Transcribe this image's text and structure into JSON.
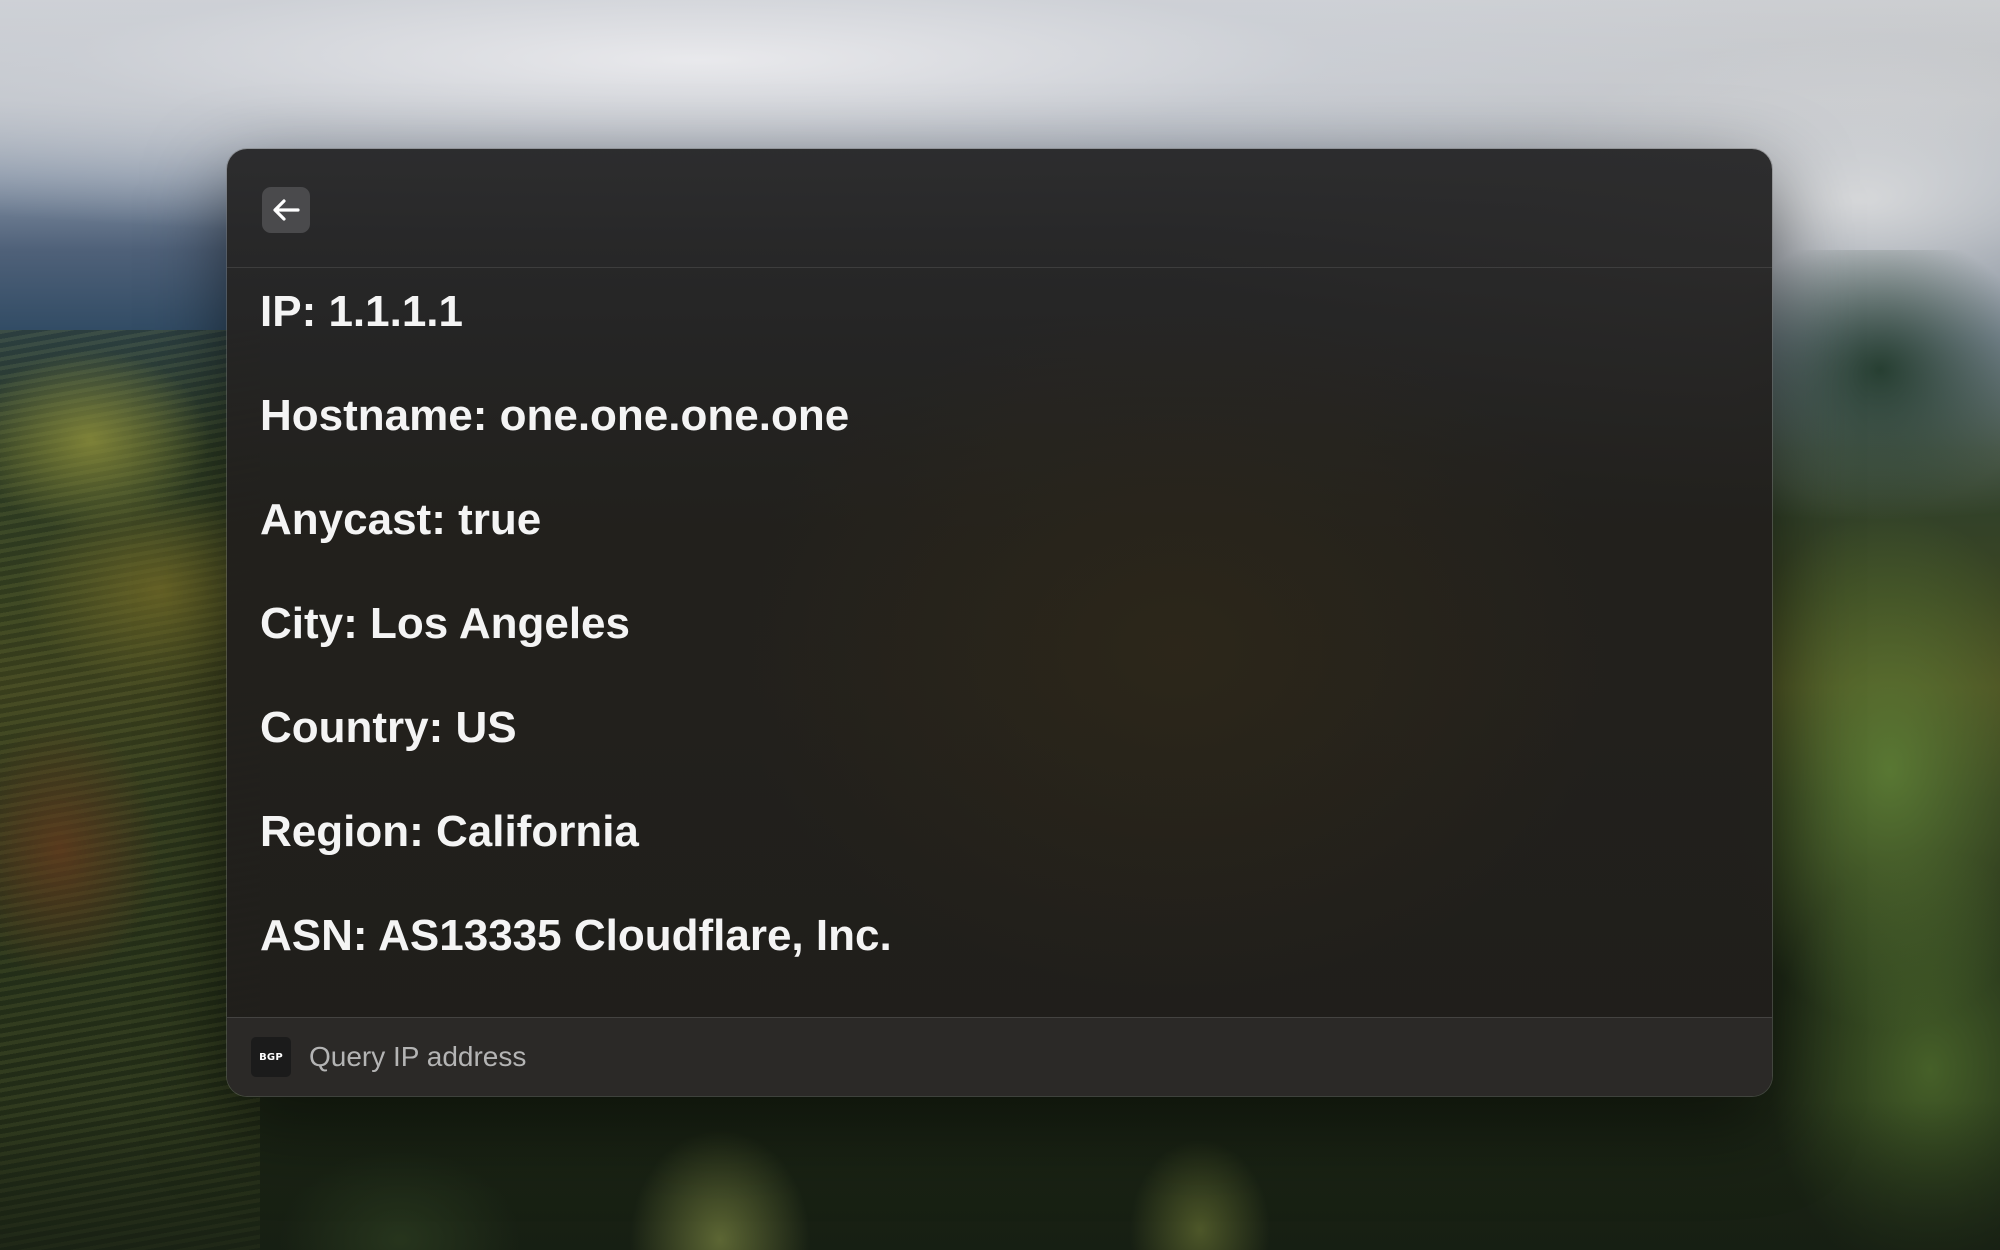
{
  "window": {
    "back_icon": "arrow-left-icon",
    "details": [
      {
        "label": "IP: 1.1.1.1"
      },
      {
        "label": "Hostname: one.one.one.one"
      },
      {
        "label": "Anycast: true"
      },
      {
        "label": "City: Los Angeles"
      },
      {
        "label": "Country: US"
      },
      {
        "label": "Region: California"
      },
      {
        "label": "ASN: AS13335 Cloudflare, Inc."
      }
    ],
    "footer": {
      "icon_text": "BGP",
      "action_label": "Query IP address"
    }
  },
  "colors": {
    "text": "#f4f4f4",
    "muted_text": "#b4b4b4",
    "back_button_bg": "#4a4a4c"
  }
}
